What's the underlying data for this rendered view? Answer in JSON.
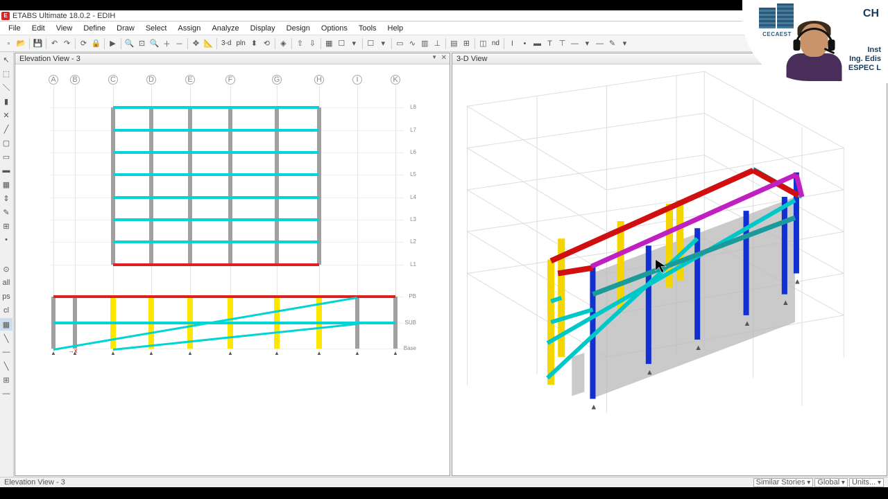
{
  "app": {
    "title": "ETABS Ultimate 18.0.2 - EDIH",
    "icon_letter": "E"
  },
  "menu": [
    "File",
    "Edit",
    "View",
    "Define",
    "Draw",
    "Select",
    "Assign",
    "Analyze",
    "Display",
    "Design",
    "Options",
    "Tools",
    "Help"
  ],
  "toolbar_text": {
    "mode3d": "3-d",
    "plan": "pln",
    "nd": "nd"
  },
  "views": {
    "left": {
      "title": "Elevation View - 3"
    },
    "right": {
      "title": "3-D View"
    }
  },
  "grids_x": [
    "A",
    "B",
    "C",
    "D",
    "E",
    "F",
    "G",
    "H",
    "I",
    "K"
  ],
  "stories": [
    "L8",
    "L7",
    "L6",
    "L5",
    "L4",
    "L3",
    "L2",
    "L1",
    "PB",
    "SUB",
    "Base"
  ],
  "status": {
    "left": "Elevation View - 3",
    "sel1": "Similar Stories",
    "sel2": "Global",
    "sel3": "Units..."
  },
  "overlay": {
    "brand1": "CECAEST",
    "brand2": "CH",
    "line1": "Inst",
    "line2": "Ing. Edis",
    "line3": "ESPEC                    L"
  }
}
